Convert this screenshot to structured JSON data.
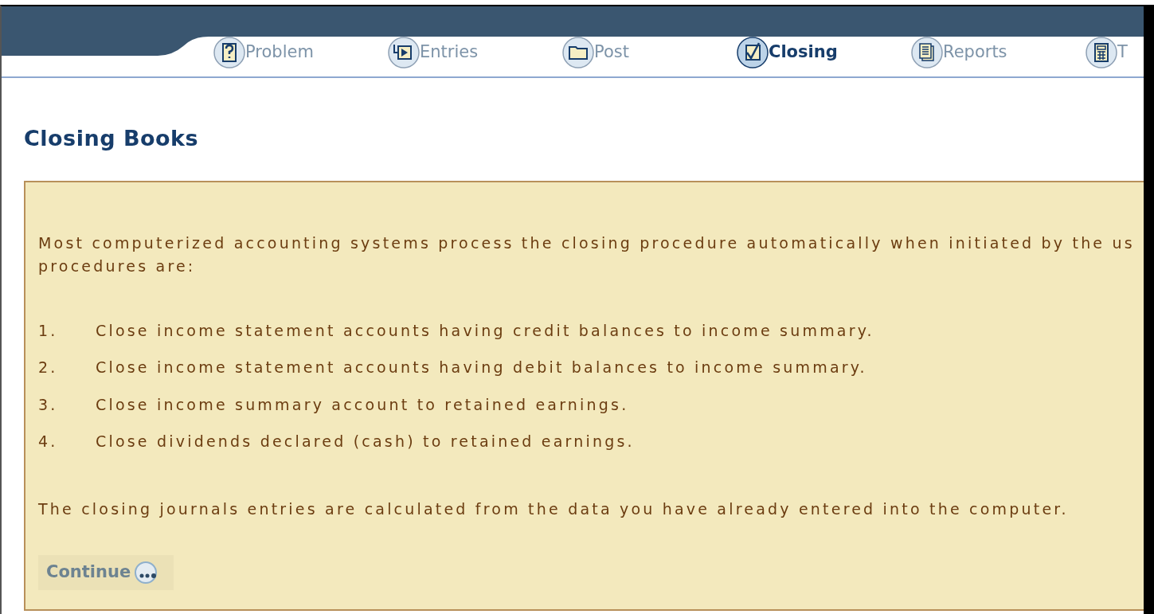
{
  "tabs": [
    {
      "label": "Problem",
      "kind": "question",
      "selected": false
    },
    {
      "label": "Entries",
      "kind": "entry",
      "selected": false
    },
    {
      "label": "Post",
      "kind": "folder",
      "selected": false
    },
    {
      "label": "Closing",
      "kind": "check",
      "selected": true
    },
    {
      "label": "Reports",
      "kind": "pages",
      "selected": false
    },
    {
      "label": "T",
      "kind": "calculator",
      "selected": false
    }
  ],
  "title": "Closing Books",
  "intro": [
    "Most computerized accounting systems process the closing procedure automatically when initiated by the us",
    "procedures are:"
  ],
  "steps": [
    {
      "number": "1.",
      "text": "Close income statement accounts having credit balances to income summary."
    },
    {
      "number": "2.",
      "text": "Close income statement accounts having debit balances to income summary."
    },
    {
      "number": "3.",
      "text": "Close income summary account to retained earnings."
    },
    {
      "number": "4.",
      "text": "Close dividends declared (cash) to retained earnings."
    }
  ],
  "note": "The closing journals entries are calculated from the data you have already entered into the computer.",
  "continue_button": "Continue"
}
